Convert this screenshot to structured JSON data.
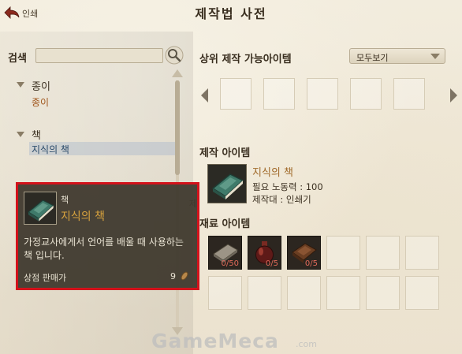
{
  "header": {
    "back_label": "인쇄",
    "title": "제작법 사전"
  },
  "search": {
    "label": "검색",
    "value": "",
    "placeholder": ""
  },
  "tree": [
    {
      "category": "종이",
      "items": [
        "종이"
      ]
    },
    {
      "category": "책",
      "items": [
        "지식의 책"
      ]
    }
  ],
  "upper_craft": {
    "title": "상위 제작 가능아이템",
    "filter_selected": "모두보기"
  },
  "craft_item": {
    "title": "제작 아이템",
    "name": "지식의 책",
    "labor_label": "필요 노동력",
    "labor_value": "100",
    "bench_label": "제작대",
    "bench_value": "인쇄기",
    "labor_line": "필요 노동력 : 100",
    "bench_line": "제작대 : 인쇄기"
  },
  "materials": {
    "title": "재료 아이템",
    "items": [
      {
        "icon": "paper-stack-icon",
        "count": "0/50"
      },
      {
        "icon": "ink-bottle-icon",
        "count": "0/5"
      },
      {
        "icon": "leather-cover-icon",
        "count": "0/5"
      }
    ]
  },
  "tooltip": {
    "item_type": "책",
    "item_name": "지식의 책",
    "description": "가정교사에게서 언어를 배울 때 사용하는 책 입니다.",
    "vendor_label": "상점 판매가",
    "price": "9",
    "price_icon": "copper-coin-icon"
  },
  "clipped_text": "제",
  "watermark": {
    "main": "GameMeca",
    "suffix": ".com"
  },
  "colors": {
    "item_name": "#a06a2a",
    "tooltip_border": "#d3121b",
    "tooltip_name": "#d7a23e",
    "count_red": "#e06a5a"
  }
}
